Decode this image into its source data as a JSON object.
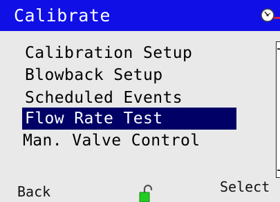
{
  "header": {
    "title": "Calibrate",
    "status_icon": "gauge-icon",
    "bar_color": "#0f0fe6"
  },
  "menu": {
    "items": [
      {
        "label": "Calibration Setup",
        "selected": false
      },
      {
        "label": "Blowback Setup",
        "selected": false
      },
      {
        "label": "Scheduled Events",
        "selected": false
      },
      {
        "label": "Flow Rate Test",
        "selected": true
      },
      {
        "label": "Man. Valve Control",
        "selected": false
      }
    ],
    "highlight_color": "#000066"
  },
  "softkeys": {
    "left_label": "Back",
    "right_label": "Select",
    "center_icon": "unlock-icon",
    "center_icon_color": "#22cc22"
  }
}
